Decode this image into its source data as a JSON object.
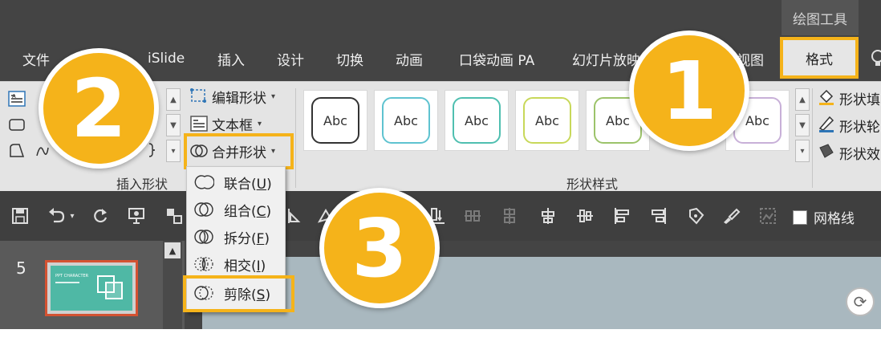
{
  "contextual_tab_title": "绘图工具",
  "tabs": [
    {
      "id": "file",
      "label": "文件"
    },
    {
      "id": "islide",
      "label": "iSlide"
    },
    {
      "id": "insert",
      "label": "插入"
    },
    {
      "id": "design",
      "label": "设计"
    },
    {
      "id": "transitions",
      "label": "切换"
    },
    {
      "id": "animations",
      "label": "动画"
    },
    {
      "id": "pocket-animation",
      "label": "口袋动画 PA"
    },
    {
      "id": "slideshow",
      "label": "幻灯片放映"
    },
    {
      "id": "view",
      "label": "视图"
    },
    {
      "id": "format",
      "label": "格式",
      "active": true
    }
  ],
  "ribbon": {
    "insert_shapes": {
      "edit_shape": "编辑形状",
      "text_box": "文本框",
      "merge_shapes": "合并形状",
      "group_label": "插入形状"
    },
    "shape_styles": {
      "thumb_text": "Abc",
      "group_label": "形状样式",
      "thumbs": [
        {
          "border": "#333333"
        },
        {
          "border": "#5fc3d0"
        },
        {
          "border": "#4fbfb0"
        },
        {
          "border": "#c8d85a"
        },
        {
          "border": "#9cc36a"
        },
        {
          "border": "#c8b0d8"
        }
      ]
    },
    "right_commands": {
      "shape_fill": "形状填",
      "shape_outline": "形状轮",
      "shape_effects": "形状效"
    }
  },
  "merge_menu": {
    "items": [
      {
        "label": "联合",
        "key": "U"
      },
      {
        "label": "组合",
        "key": "C"
      },
      {
        "label": "拆分",
        "key": "F"
      },
      {
        "label": "相交",
        "key": "I"
      },
      {
        "label": "剪除",
        "key": "S",
        "highlighted": true
      }
    ]
  },
  "quick_access": {
    "gridlines_label": "网格线"
  },
  "slide_panel": {
    "slide_number": "5",
    "thumb_text": "PPT CHARACTER"
  },
  "badges": [
    "1",
    "2",
    "3"
  ],
  "colors": {
    "accent": "#f5b31a",
    "dark_bg": "#444444",
    "ribbon_bg": "#e4e4e4",
    "slide_accent": "#4fb8a5"
  }
}
